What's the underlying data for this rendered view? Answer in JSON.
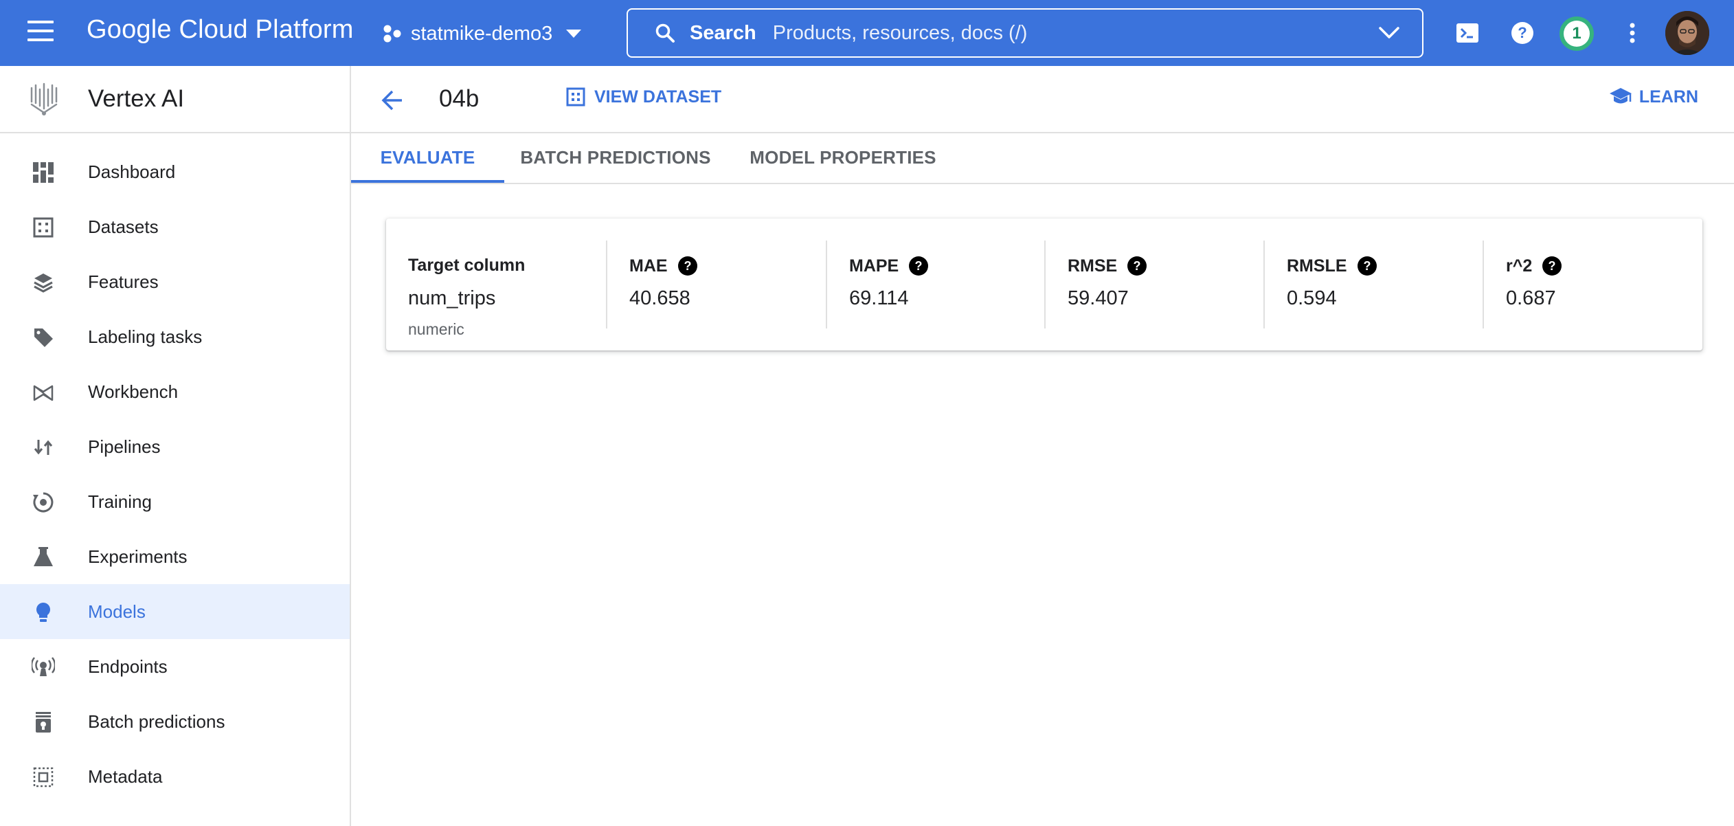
{
  "topbar": {
    "brand": "Google Cloud Platform",
    "project": "statmike-demo3",
    "search_label": "Search",
    "search_placeholder": "Products, resources, docs (/)",
    "notification_count": "1",
    "colors": {
      "bar": "#3b73dc",
      "notification": "#36b37e"
    }
  },
  "sidebar": {
    "product": "Vertex AI",
    "items": [
      {
        "label": "Dashboard",
        "icon": "dashboard-icon"
      },
      {
        "label": "Datasets",
        "icon": "datasets-icon"
      },
      {
        "label": "Features",
        "icon": "features-icon"
      },
      {
        "label": "Labeling tasks",
        "icon": "label-tag-icon"
      },
      {
        "label": "Workbench",
        "icon": "workbench-icon"
      },
      {
        "label": "Pipelines",
        "icon": "pipelines-icon"
      },
      {
        "label": "Training",
        "icon": "training-icon"
      },
      {
        "label": "Experiments",
        "icon": "flask-icon"
      },
      {
        "label": "Models",
        "icon": "lightbulb-icon",
        "active": true
      },
      {
        "label": "Endpoints",
        "icon": "endpoints-icon"
      },
      {
        "label": "Batch predictions",
        "icon": "batch-predictions-icon"
      },
      {
        "label": "Metadata",
        "icon": "metadata-icon"
      }
    ]
  },
  "header": {
    "model_name": "04b",
    "view_dataset": "VIEW DATASET",
    "learn": "LEARN"
  },
  "tabs": [
    {
      "label": "EVALUATE",
      "active": true
    },
    {
      "label": "BATCH PREDICTIONS",
      "active": false
    },
    {
      "label": "MODEL PROPERTIES",
      "active": false
    }
  ],
  "metrics": {
    "target": {
      "label": "Target column",
      "value": "num_trips",
      "type": "numeric"
    },
    "mae": {
      "label": "MAE",
      "value": "40.658"
    },
    "mape": {
      "label": "MAPE",
      "value": "69.114"
    },
    "rmse": {
      "label": "RMSE",
      "value": "59.407"
    },
    "rmsle": {
      "label": "RMSLE",
      "value": "0.594"
    },
    "r2": {
      "label": "r^2",
      "value": "0.687"
    }
  }
}
